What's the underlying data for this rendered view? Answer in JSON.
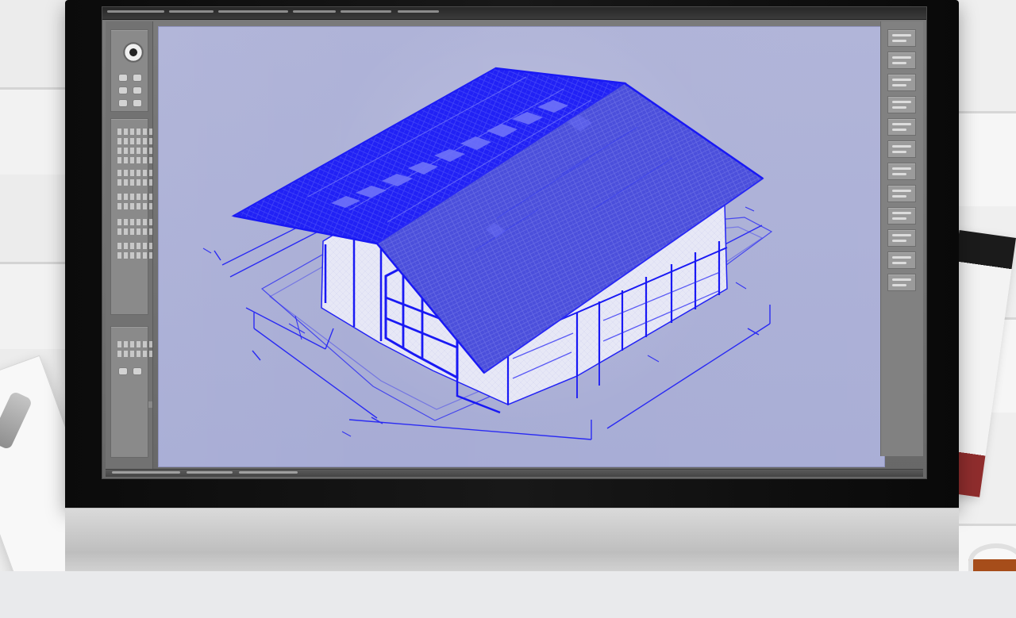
{
  "scene": {
    "accent": "#1f23ff",
    "viewport_bg": "#afb3da",
    "screen_frame": "#111111",
    "stand": "#d6d6d6"
  },
  "icons": {
    "cad_orbit_control": "orbit-icon",
    "tool_button": "tool-icon"
  }
}
